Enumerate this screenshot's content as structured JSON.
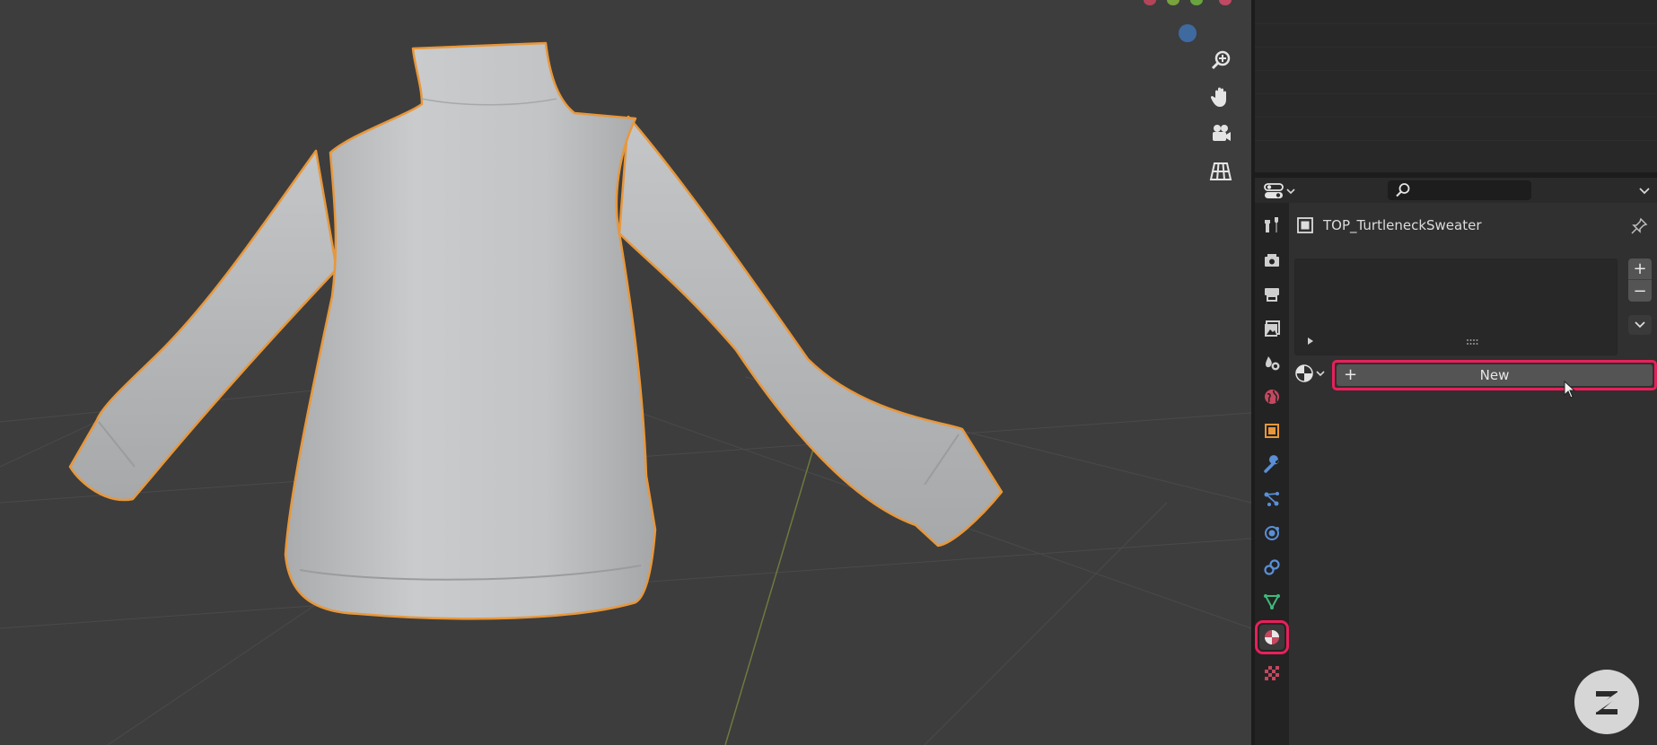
{
  "properties": {
    "object_name": "TOP_TurtleneckSweater",
    "new_button_label": "New",
    "add_slot_label": "+",
    "remove_slot_label": "−",
    "new_plus_label": "+",
    "search_placeholder": ""
  },
  "colors": {
    "highlight": "#e8205a",
    "selection_outline": "#e8973a",
    "viewport_bg": "#3d3d3d",
    "panel_bg": "#303030"
  },
  "icons": {
    "viewport_nav": [
      "zoom-icon",
      "hand-icon",
      "camera-icon",
      "grid-icon"
    ],
    "property_tabs": [
      "tool-icon",
      "render-icon",
      "output-icon",
      "view-layer-icon",
      "scene-icon",
      "world-icon",
      "object-icon",
      "modifier-icon",
      "particles-icon",
      "physics-icon",
      "constraints-icon",
      "data-icon",
      "material-icon",
      "texture-icon"
    ],
    "active_tab": "material-icon"
  }
}
